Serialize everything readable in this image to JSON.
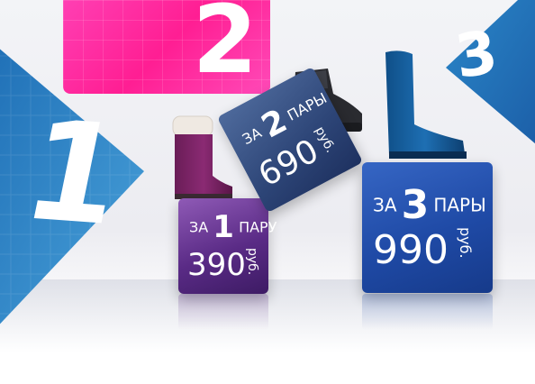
{
  "numbers": {
    "left": "1",
    "top": "2",
    "right": "3"
  },
  "offers": [
    {
      "prefix": "ЗА",
      "qty": "1",
      "unit": "ПАРУ",
      "price": "390",
      "currency": "руб."
    },
    {
      "prefix": "ЗА",
      "qty": "2",
      "unit": "ПАРЫ",
      "price": "690",
      "currency": "руб."
    },
    {
      "prefix": "ЗА",
      "qty": "3",
      "unit": "ПАРЫ",
      "price": "990",
      "currency": "руб."
    }
  ],
  "colors": {
    "pink": "#ff1e93",
    "blue_triangle": "#2f86c4",
    "box1": "#5a2b86",
    "box2": "#2d4577",
    "box3": "#1f4aa6"
  },
  "images": [
    "purple-winter-boot",
    "black-sneaker-boot",
    "blue-tall-boot"
  ]
}
